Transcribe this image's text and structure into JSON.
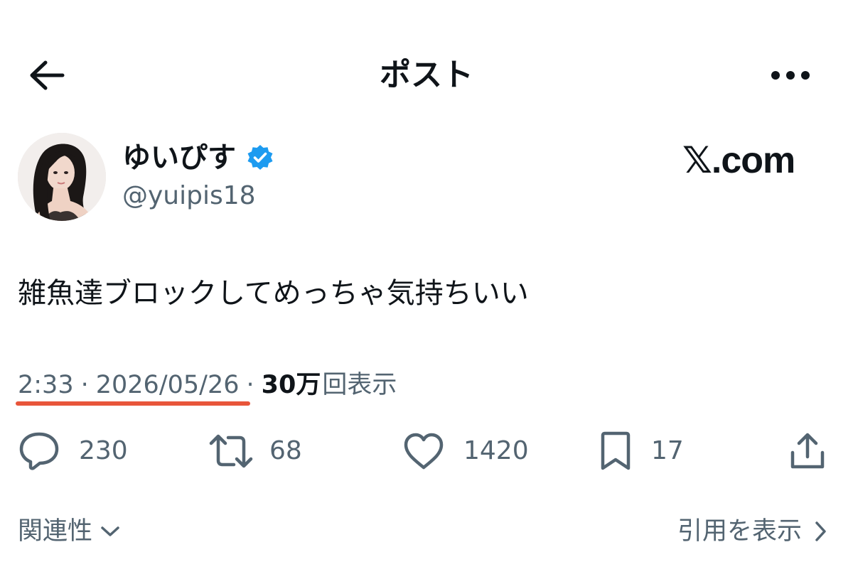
{
  "header": {
    "title": "ポスト",
    "back_icon": "arrow-left-icon",
    "more_icon": "more-horizontal-icon"
  },
  "author": {
    "display_name": "ゆいぴす",
    "handle": "@yuipis18",
    "verified": true,
    "verified_color": "#1d9bf0"
  },
  "watermark": "𝕏.com",
  "tweet": {
    "text": "雑魚達ブロックしてめっちゃ気持ちいい",
    "time": "2:33",
    "date": "2026/05/26",
    "separator": "·",
    "views_count": "30万",
    "views_label": "回表示",
    "underline_color": "#e8553a"
  },
  "actions": {
    "replies": "230",
    "retweets": "68",
    "likes": "1420",
    "bookmarks": "17"
  },
  "footer": {
    "related_label": "関連性",
    "quotes_label": "引用を表示"
  },
  "colors": {
    "text_primary": "#0f1419",
    "text_secondary": "#536471"
  }
}
